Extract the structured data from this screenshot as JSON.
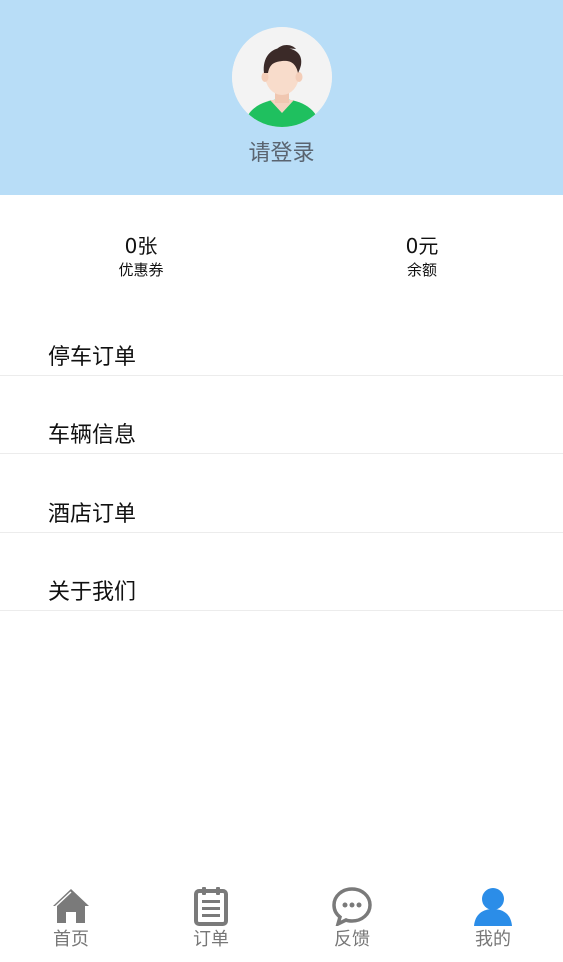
{
  "header": {
    "login_text": "请登录",
    "background_color": "#b8ddf7",
    "avatar_icon": "default-user-avatar"
  },
  "stats": {
    "coupons": {
      "value": "0张",
      "label": "优惠券"
    },
    "balance": {
      "value": "0元",
      "label": "余额"
    }
  },
  "menu": {
    "items": [
      {
        "label": "停车订单"
      },
      {
        "label": "车辆信息"
      },
      {
        "label": "酒店订单"
      },
      {
        "label": "关于我们"
      }
    ]
  },
  "tabbar": {
    "tabs": [
      {
        "label": "首页",
        "icon": "home-icon",
        "active": false
      },
      {
        "label": "订单",
        "icon": "clipboard-icon",
        "active": false
      },
      {
        "label": "反馈",
        "icon": "chat-bubble-icon",
        "active": false
      },
      {
        "label": "我的",
        "icon": "user-icon",
        "active": true
      }
    ],
    "inactive_color": "#7a7a7a",
    "active_color": "#2b8de8"
  }
}
